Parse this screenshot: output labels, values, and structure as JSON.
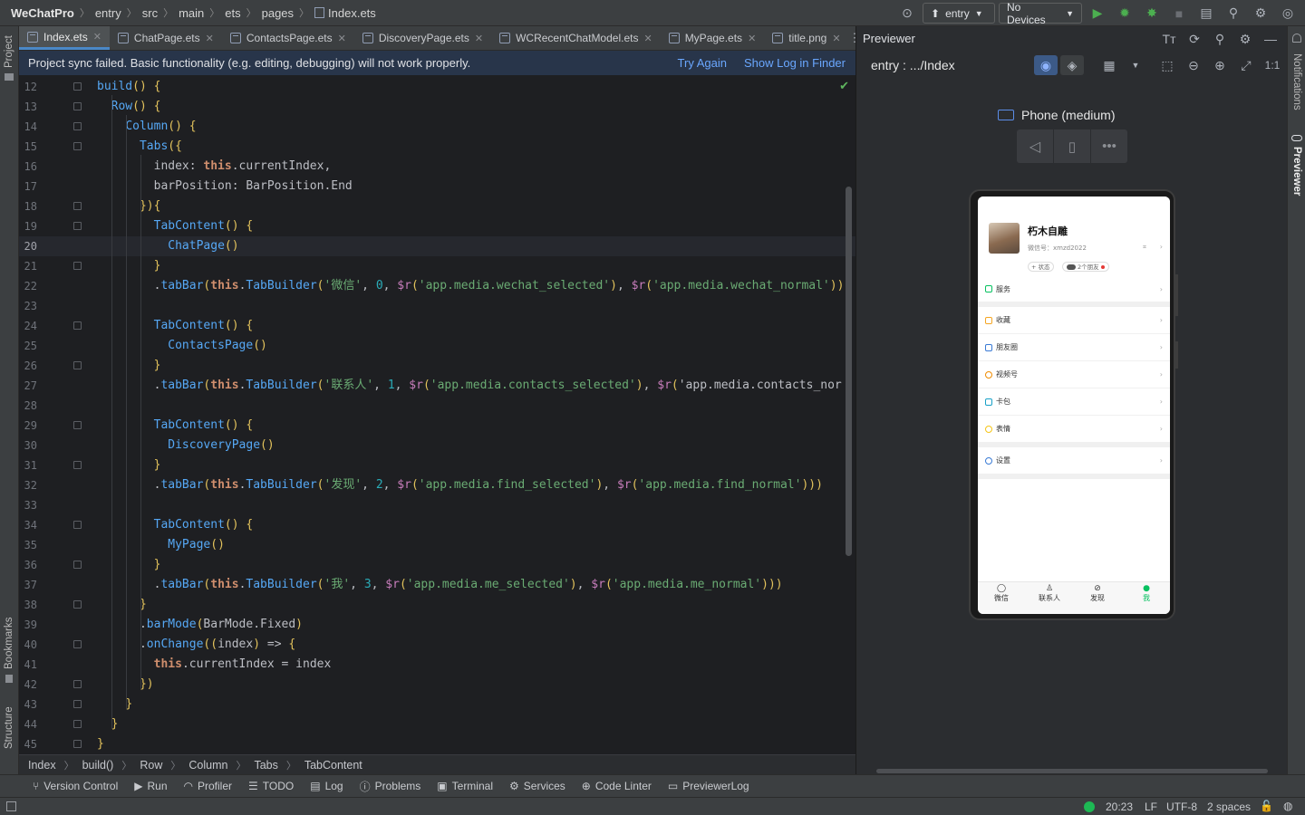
{
  "titlebar": {
    "project": "WeChatPro",
    "path": [
      "entry",
      "src",
      "main",
      "ets",
      "pages"
    ],
    "file": "Index.ets",
    "module_dropdown": "entry",
    "device_dropdown": "No Devices"
  },
  "tabs": [
    {
      "label": "Index.ets",
      "active": true
    },
    {
      "label": "ChatPage.ets",
      "active": false
    },
    {
      "label": "ContactsPage.ets",
      "active": false
    },
    {
      "label": "DiscoveryPage.ets",
      "active": false
    },
    {
      "label": "WCRecentChatModel.ets",
      "active": false
    },
    {
      "label": "MyPage.ets",
      "active": false
    },
    {
      "label": "title.png",
      "active": false
    }
  ],
  "banner": {
    "message": "Project sync failed. Basic functionality (e.g. editing, debugging) will not work properly.",
    "try_again": "Try Again",
    "show_log": "Show Log in Finder"
  },
  "code": {
    "current_line": "20",
    "lines": [
      {
        "n": "12",
        "t": "    build() {"
      },
      {
        "n": "13",
        "t": "      Row() {"
      },
      {
        "n": "14",
        "t": "        Column() {"
      },
      {
        "n": "15",
        "t": "          Tabs({"
      },
      {
        "n": "16",
        "t": "            index: this.currentIndex,"
      },
      {
        "n": "17",
        "t": "            barPosition: BarPosition.End"
      },
      {
        "n": "18",
        "t": "          }){"
      },
      {
        "n": "19",
        "t": "            TabContent() {"
      },
      {
        "n": "20",
        "t": "              ChatPage()"
      },
      {
        "n": "21",
        "t": "            }"
      },
      {
        "n": "22",
        "t": "            .tabBar(this.TabBuilder('微信', 0, $r('app.media.wechat_selected'), $r('app.media.wechat_normal'))"
      },
      {
        "n": "23",
        "t": ""
      },
      {
        "n": "24",
        "t": "            TabContent() {"
      },
      {
        "n": "25",
        "t": "              ContactsPage()"
      },
      {
        "n": "26",
        "t": "            }"
      },
      {
        "n": "27",
        "t": "            .tabBar(this.TabBuilder('联系人', 1, $r('app.media.contacts_selected'), $r('app.media.contacts_nor"
      },
      {
        "n": "28",
        "t": ""
      },
      {
        "n": "29",
        "t": "            TabContent() {"
      },
      {
        "n": "30",
        "t": "              DiscoveryPage()"
      },
      {
        "n": "31",
        "t": "            }"
      },
      {
        "n": "32",
        "t": "            .tabBar(this.TabBuilder('发现', 2, $r('app.media.find_selected'), $r('app.media.find_normal')))"
      },
      {
        "n": "33",
        "t": ""
      },
      {
        "n": "34",
        "t": "            TabContent() {"
      },
      {
        "n": "35",
        "t": "              MyPage()"
      },
      {
        "n": "36",
        "t": "            }"
      },
      {
        "n": "37",
        "t": "            .tabBar(this.TabBuilder('我', 3, $r('app.media.me_selected'), $r('app.media.me_normal')))"
      },
      {
        "n": "38",
        "t": "          }"
      },
      {
        "n": "39",
        "t": "          .barMode(BarMode.Fixed)"
      },
      {
        "n": "40",
        "t": "          .onChange((index) => {"
      },
      {
        "n": "41",
        "t": "            this.currentIndex = index"
      },
      {
        "n": "42",
        "t": "          })"
      },
      {
        "n": "43",
        "t": "        }"
      },
      {
        "n": "44",
        "t": "      }"
      },
      {
        "n": "45",
        "t": "    }"
      }
    ]
  },
  "breadcrumb": [
    "Index",
    "build()",
    "Row",
    "Column",
    "Tabs",
    "TabContent"
  ],
  "toolwindows": [
    "Version Control",
    "Run",
    "Profiler",
    "TODO",
    "Log",
    "Problems",
    "Terminal",
    "Services",
    "Code Linter",
    "PreviewerLog"
  ],
  "status": {
    "position": "20:23",
    "line_sep": "LF",
    "encoding": "UTF-8",
    "indent": "2 spaces"
  },
  "side_labels": {
    "project": "Project",
    "bookmarks": "Bookmarks",
    "structure": "Structure",
    "notifications": "Notifications",
    "previewer": "Previewer"
  },
  "previewer": {
    "title": "Previewer",
    "route": "entry : .../Index",
    "device": "Phone (medium)",
    "profile": {
      "name": "朽木自雕",
      "wechat_id": "微信号：xmzd2022",
      "status_btn": "+ 状态",
      "friends_btn": "2个朋友"
    },
    "menu": [
      "服务",
      "收藏",
      "朋友圈",
      "视频号",
      "卡包",
      "表情",
      "设置"
    ],
    "nav": [
      "微信",
      "联系人",
      "发现",
      "我"
    ]
  },
  "colors": {
    "accent": "#4a88c7",
    "run_green": "#4caf50",
    "link": "#6aa7ff",
    "banner_bg": "#28354a",
    "wechat_green": "#07c160"
  }
}
